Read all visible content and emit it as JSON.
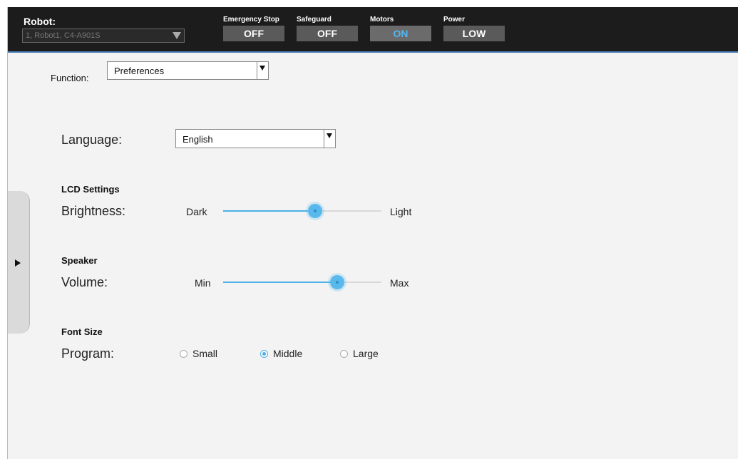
{
  "header": {
    "robot_label": "Robot:",
    "robot_value": "1, Robot1, C4-A901S",
    "status": [
      {
        "label": "Emergency Stop",
        "value": "OFF"
      },
      {
        "label": "Safeguard",
        "value": "OFF"
      },
      {
        "label": "Motors",
        "value": "ON"
      },
      {
        "label": "Power",
        "value": "LOW"
      }
    ]
  },
  "function": {
    "label": "Function:",
    "value": "Preferences"
  },
  "language": {
    "label": "Language:",
    "value": "English"
  },
  "lcd": {
    "heading": "LCD Settings",
    "label": "Brightness:",
    "min_label": "Dark",
    "max_label": "Light",
    "level": 0.58
  },
  "speaker": {
    "heading": "Speaker",
    "label": "Volume:",
    "min_label": "Min",
    "max_label": "Max",
    "level": 0.72
  },
  "font_size": {
    "heading": "Font Size",
    "label": "Program:",
    "options": [
      {
        "label": "Small",
        "checked": false
      },
      {
        "label": "Middle",
        "checked": true
      },
      {
        "label": "Large",
        "checked": false
      }
    ]
  },
  "colors": {
    "accent": "#4cb2e6",
    "header_bg": "#1c1c1c",
    "motors_on": "#55b6ee"
  },
  "icons": {
    "side_tab": "play-triangle-icon",
    "dropdown": "dropdown-arrow-icon"
  }
}
